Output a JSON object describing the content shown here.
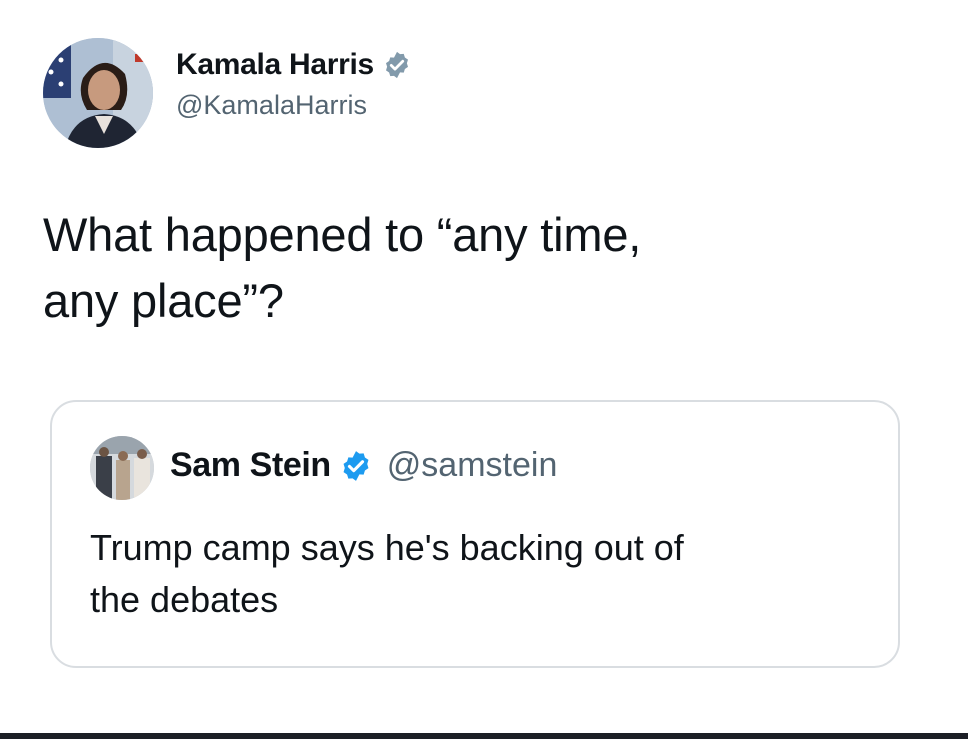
{
  "author": {
    "display_name": "Kamala Harris",
    "handle": "@KamalaHarris"
  },
  "tweet": {
    "text_line1": "What happened to “any time,",
    "text_line2": "any place”?"
  },
  "quoted_tweet": {
    "display_name": "Sam Stein",
    "handle": "@samstein",
    "text_line1": "Trump camp says he's backing out of",
    "text_line2": "the debates"
  },
  "colors": {
    "verified_blue": "#1d9bf0",
    "handle_gray": "#536471",
    "text_black": "#0f1419",
    "card_border": "#d9dde1"
  },
  "icons": {
    "verified": "verified-badge-icon"
  }
}
